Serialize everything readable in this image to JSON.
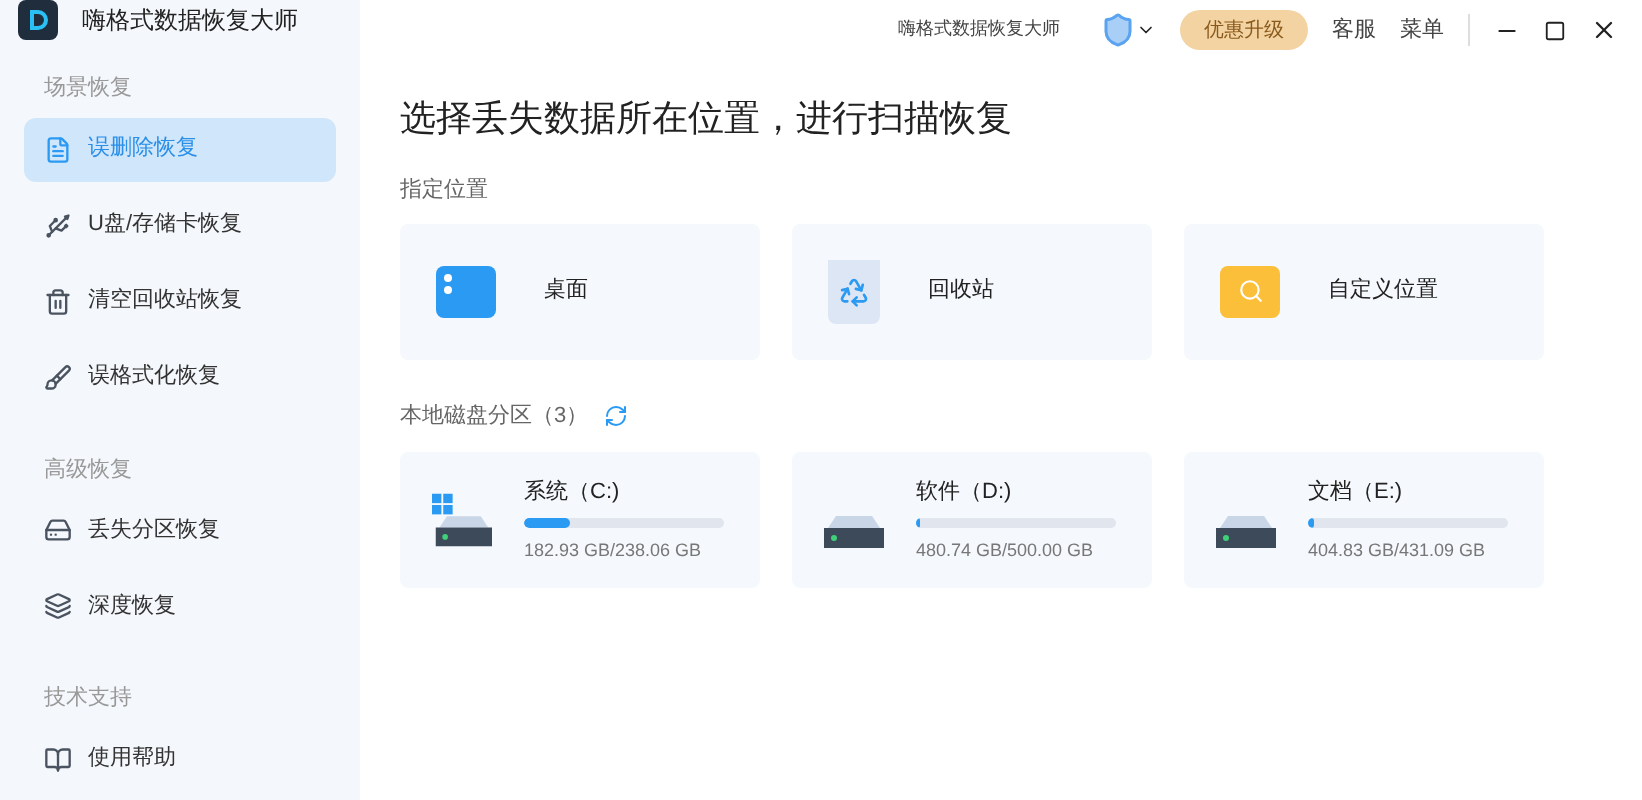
{
  "app": {
    "name": "嗨格式数据恢复大师"
  },
  "titlebar": {
    "title": "嗨格式数据恢复大师",
    "upgrade": "优惠升级",
    "links": [
      "客服",
      "菜单"
    ]
  },
  "sidebar": {
    "sections": [
      {
        "title": "场景恢复",
        "items": [
          {
            "label": "误删除恢复",
            "selected": true
          },
          {
            "label": "U盘/存储卡恢复",
            "selected": false
          },
          {
            "label": "清空回收站恢复",
            "selected": false
          },
          {
            "label": "误格式化恢复",
            "selected": false
          }
        ]
      },
      {
        "title": "高级恢复",
        "items": [
          {
            "label": "丢失分区恢复",
            "selected": false
          },
          {
            "label": "深度恢复",
            "selected": false
          }
        ]
      },
      {
        "title": "技术支持",
        "items": [
          {
            "label": "使用帮助",
            "selected": false
          }
        ]
      }
    ]
  },
  "heading": "选择丢失数据所在位置，进行扫描恢复",
  "locations": {
    "title": "指定位置",
    "items": [
      {
        "kind": "desktop",
        "label": "桌面"
      },
      {
        "kind": "recycle",
        "label": "回收站"
      },
      {
        "kind": "folder",
        "label": "自定义位置"
      }
    ]
  },
  "disks": {
    "title": "本地磁盘分区（3）",
    "items": [
      {
        "kind": "system",
        "name": "系统（C:)",
        "level": 0.23,
        "usage": "182.93 GB/238.06 GB"
      },
      {
        "kind": "drive",
        "name": "软件（D:)",
        "level": 0.02,
        "usage": "480.74 GB/500.00 GB"
      },
      {
        "kind": "drive",
        "name": "文档（E:)",
        "level": 0.03,
        "usage": "404.83 GB/431.09 GB"
      }
    ]
  }
}
